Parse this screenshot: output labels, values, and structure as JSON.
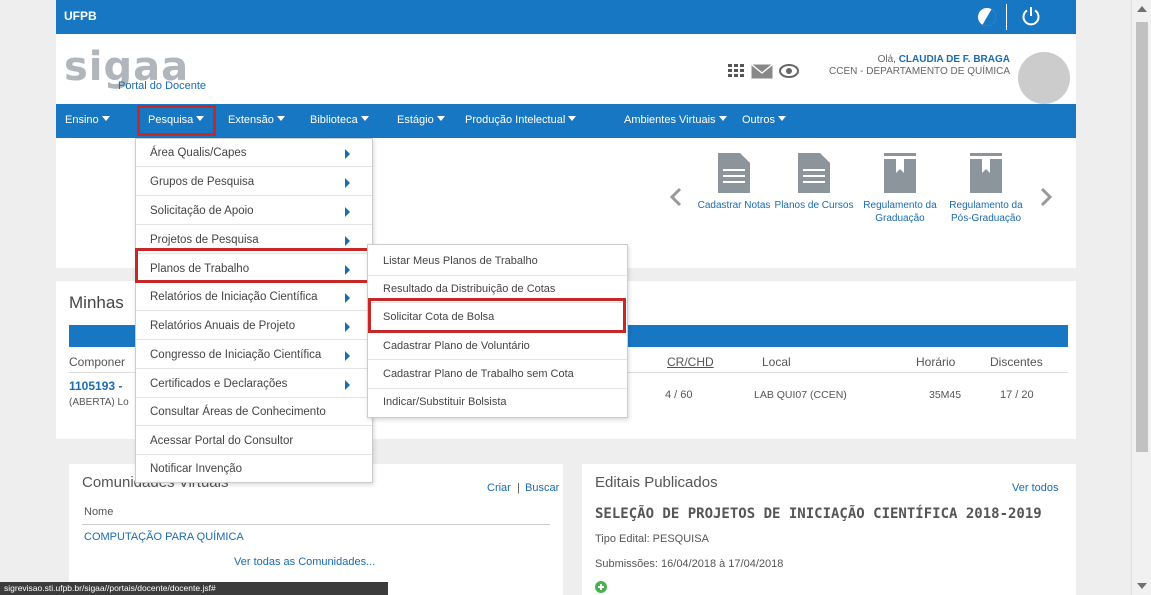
{
  "topbar": {
    "brand": "UFPB"
  },
  "header": {
    "logo": "sigaa",
    "portal": "Portal do Docente",
    "greeting_prefix": "Olá, ",
    "user_name": "CLAUDIA DE F. BRAGA",
    "department": "CCEN - DEPARTAMENTO DE QUÍMICA"
  },
  "nav": {
    "items": [
      {
        "label": "Ensino"
      },
      {
        "label": "Pesquisa"
      },
      {
        "label": "Extensão"
      },
      {
        "label": "Biblioteca"
      },
      {
        "label": "Estágio"
      },
      {
        "label": "Produção Intelectual"
      },
      {
        "label": "Ambientes Virtuais"
      },
      {
        "label": "Outros"
      }
    ]
  },
  "pesquisa_menu": {
    "items": [
      {
        "label": "Área Qualis/Capes",
        "submenu": true
      },
      {
        "label": "Grupos de Pesquisa",
        "submenu": true
      },
      {
        "label": "Solicitação de Apoio",
        "submenu": true
      },
      {
        "label": "Projetos de Pesquisa",
        "submenu": true
      },
      {
        "label": "Planos de Trabalho",
        "submenu": true
      },
      {
        "label": "Relatórios de Iniciação Científica",
        "submenu": true
      },
      {
        "label": "Relatórios Anuais de Projeto",
        "submenu": true
      },
      {
        "label": "Congresso de Iniciação Científica",
        "submenu": true
      },
      {
        "label": "Certificados e Declarações",
        "submenu": true
      },
      {
        "label": "Consultar Áreas de Conhecimento",
        "submenu": false
      },
      {
        "label": "Acessar Portal do Consultor",
        "submenu": false
      },
      {
        "label": "Notificar Invenção",
        "submenu": false
      }
    ]
  },
  "planos_submenu": {
    "items": [
      {
        "label": "Listar Meus Planos de Trabalho"
      },
      {
        "label": "Resultado da Distribuição de Cotas"
      },
      {
        "label": "Solicitar Cota de Bolsa"
      },
      {
        "label": "Cadastrar Plano de Voluntário"
      },
      {
        "label": "Cadastrar Plano de Trabalho sem Cota"
      },
      {
        "label": "Indicar/Substituir Bolsista"
      }
    ]
  },
  "quick_access": {
    "items": [
      {
        "label": "Cadastrar Notas",
        "icon": "document-icon"
      },
      {
        "label": "Planos de Cursos",
        "icon": "document-icon"
      },
      {
        "label": "Regulamento da Graduação",
        "icon": "book-icon"
      },
      {
        "label": "Regulamento da Pós-Graduação",
        "icon": "book-icon"
      }
    ]
  },
  "turmas": {
    "title": "Minhas",
    "headers": {
      "componente": "Componer",
      "crchd": "CR/CHD",
      "local": "Local",
      "horario": "Horário",
      "discentes": "Discentes"
    },
    "row": {
      "code": "1105193 -",
      "status": "(ABERTA) Lo",
      "crchd": "4 / 60",
      "local": "LAB QUI07 (CCEN)",
      "horario": "35M45",
      "discentes": "17 / 20"
    }
  },
  "comunidades": {
    "title": "Comunidades Virtuais",
    "criar": "Criar",
    "divider": "|",
    "buscar": "Buscar",
    "col_nome": "Nome",
    "item": "COMPUTAÇÃO PARA QUÍMICA",
    "ver_todas": "Ver todas as Comunidades..."
  },
  "editais": {
    "title": "Editais Publicados",
    "ver_todos": "Ver todos",
    "headline": "SELEÇÃO DE PROJETOS DE INICIAÇÃO CIENTÍFICA 2018-2019",
    "tipo": "Tipo Edital: PESQUISA",
    "submissoes": "Submissões: 16/04/2018 à 17/04/2018"
  },
  "statusbar": {
    "url": "sigrevisao.sti.ufpb.br/sigaa//portais/docente/docente.jsf#"
  },
  "colors": {
    "primary": "#1877c2",
    "highlight": "#c62828",
    "link": "#1a6bb0"
  }
}
